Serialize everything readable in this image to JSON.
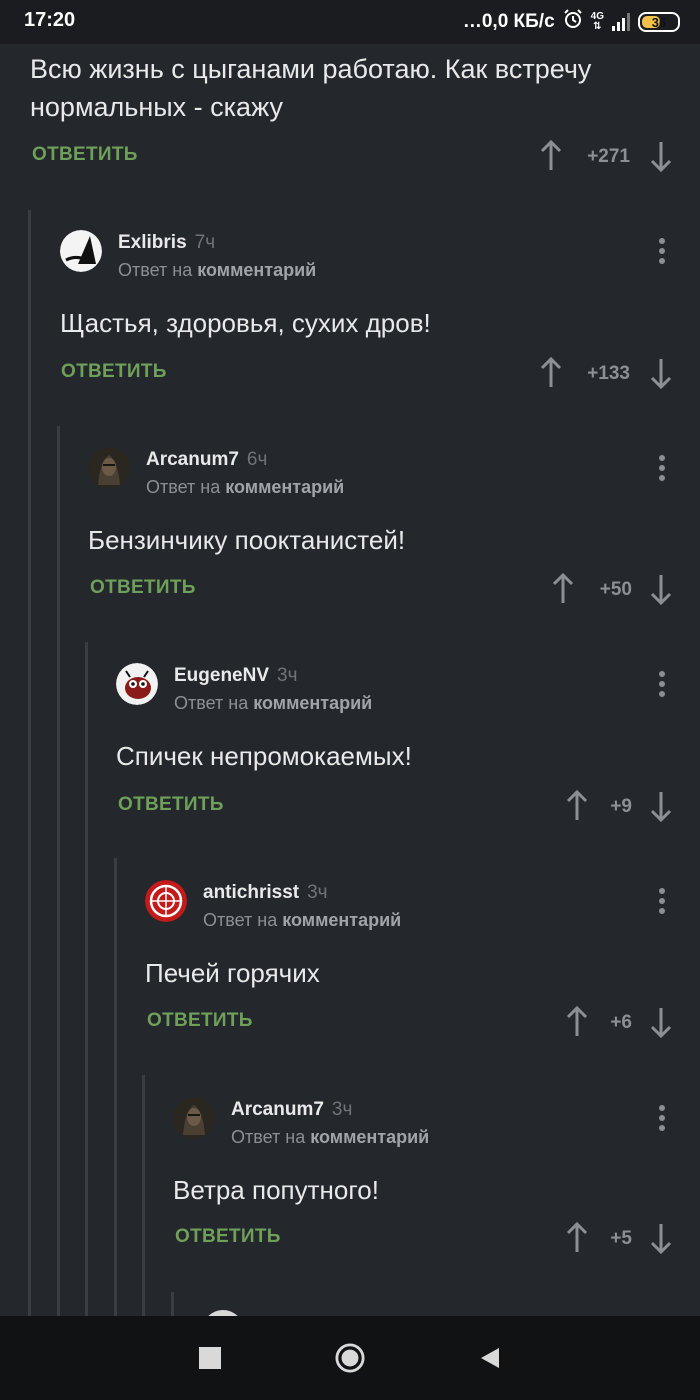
{
  "status_bar": {
    "time": "17:20",
    "speed": "…0,0 КБ/с",
    "network": "4G",
    "battery": "36"
  },
  "top_comment": {
    "text": "Всю жизнь с цыганами работаю. Как встречу нормальных - скажу",
    "reply_label": "ОТВЕТИТЬ",
    "score": "+271"
  },
  "comments": [
    {
      "author": "Exlibris",
      "time": "7ч",
      "meta_prefix": "Ответ на",
      "meta_link": "комментарий",
      "text": "Щастья, здоровья, сухих дров!",
      "reply_label": "ОТВЕТИТЬ",
      "score": "+133"
    },
    {
      "author": "Arcanum7",
      "time": "6ч",
      "meta_prefix": "Ответ на",
      "meta_link": "комментарий",
      "text": "Бензинчику пооктанистей!",
      "reply_label": "ОТВЕТИТЬ",
      "score": "+50"
    },
    {
      "author": "EugeneNV",
      "time": "3ч",
      "meta_prefix": "Ответ на",
      "meta_link": "комментарий",
      "text": "Спичек непромокаемых!",
      "reply_label": "ОТВЕТИТЬ",
      "score": "+9"
    },
    {
      "author": "antichrisst",
      "time": "3ч",
      "meta_prefix": "Ответ на",
      "meta_link": "комментарий",
      "text": "Печей горячих",
      "reply_label": "ОТВЕТИТЬ",
      "score": "+6"
    },
    {
      "author": "Arcanum7",
      "time": "3ч",
      "meta_prefix": "Ответ на",
      "meta_link": "комментарий",
      "text": "Ветра попутного!",
      "reply_label": "ОТВЕТИТЬ",
      "score": "+5"
    }
  ],
  "colors": {
    "background": "#24272b",
    "reply_green": "#6ea05a",
    "muted": "#8c8f93"
  }
}
